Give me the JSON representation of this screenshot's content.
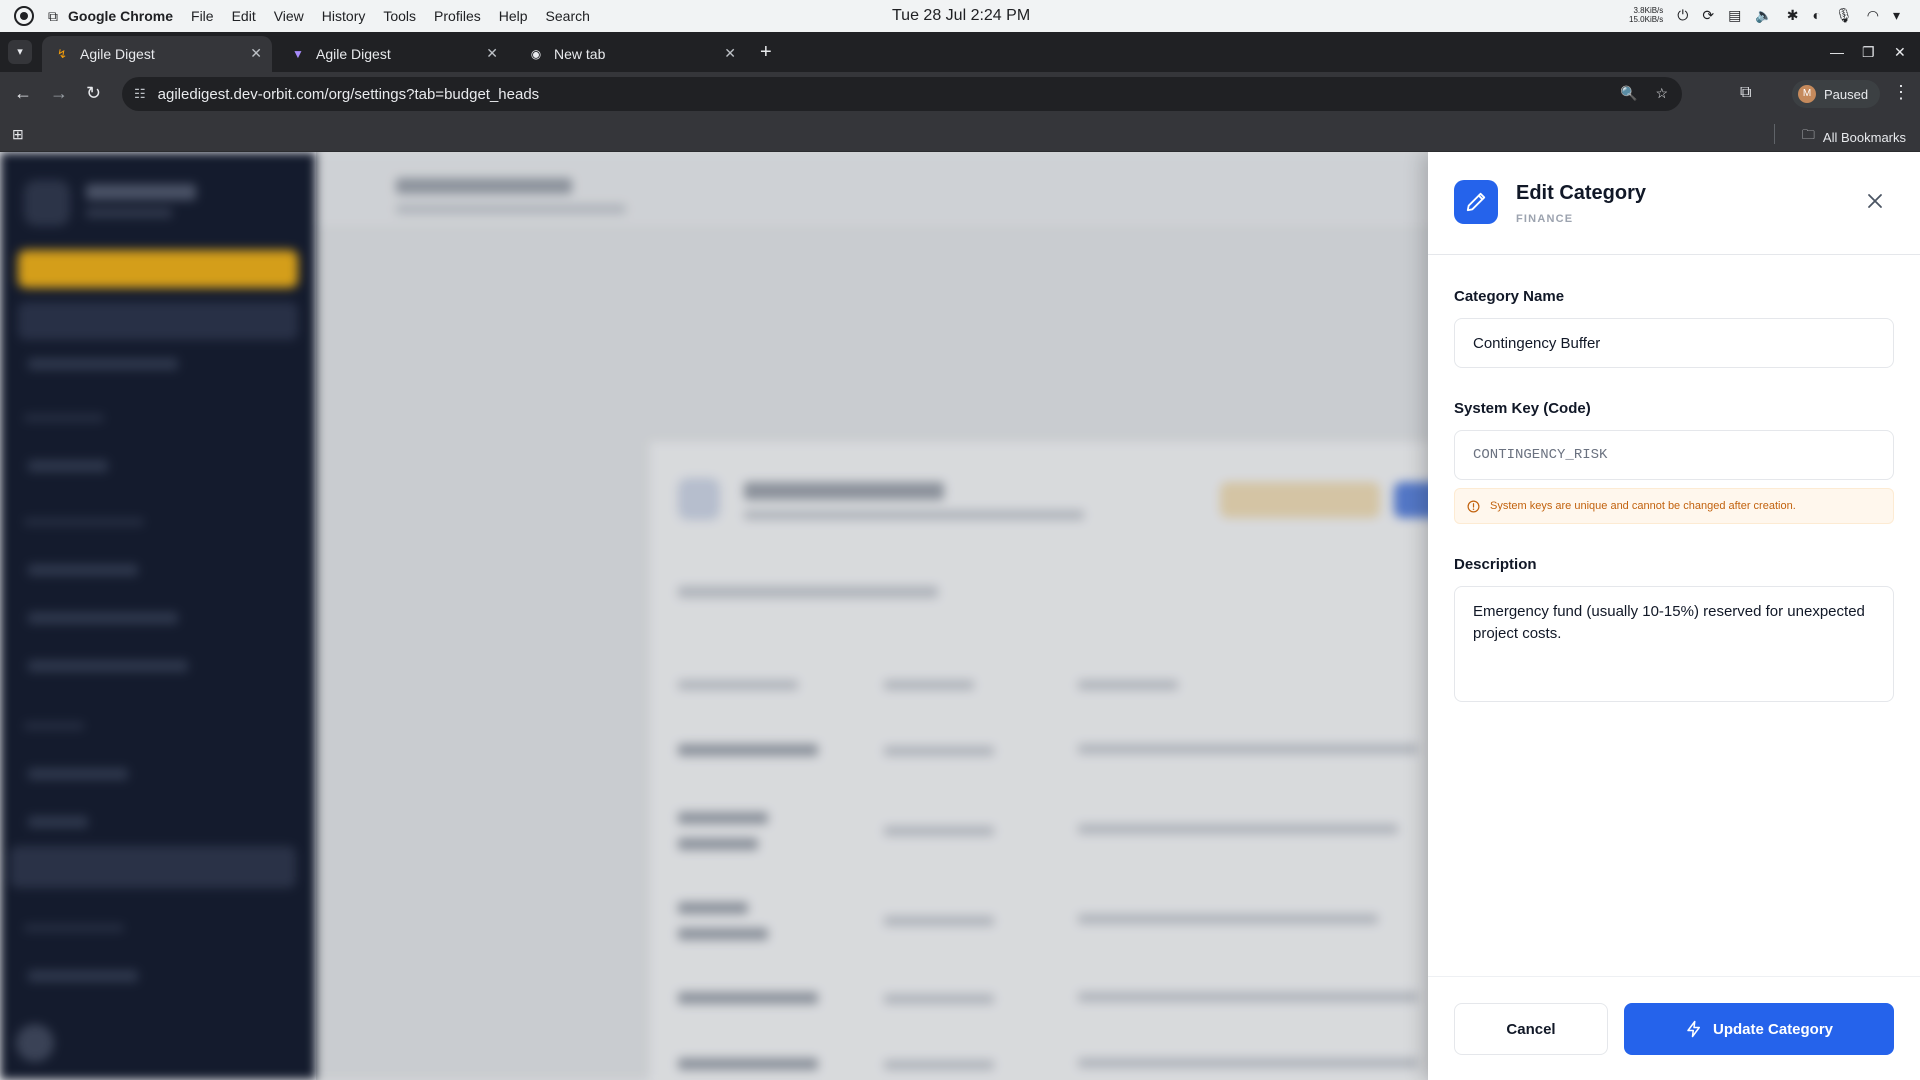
{
  "os": {
    "app_name": "Google Chrome",
    "menu": [
      "File",
      "Edit",
      "View",
      "History",
      "Tools",
      "Profiles",
      "Help",
      "Search"
    ],
    "clock": "Tue 28 Jul  2:24 PM",
    "net_up": "3.8KiB/s",
    "net_down": "15.0KiB/s"
  },
  "browser": {
    "tabs": [
      {
        "title": "Agile Digest",
        "active": true
      },
      {
        "title": "Agile Digest",
        "active": false
      },
      {
        "title": "New tab",
        "active": false
      }
    ],
    "url": "agiledigest.dev-orbit.com/org/settings?tab=budget_heads",
    "profile_initial": "M",
    "profile_status": "Paused",
    "bookmarks_label": "All Bookmarks"
  },
  "drawer": {
    "title": "Edit Category",
    "subtitle": "FINANCE",
    "fields": {
      "name_label": "Category Name",
      "name_value": "Contingency Buffer",
      "key_label": "System Key (Code)",
      "key_value": "CONTINGENCY_RISK",
      "key_warning": "System keys are unique and cannot be changed after creation.",
      "description_label": "Description",
      "description_value": "Emergency fund (usually 10-15%) reserved for unexpected project costs."
    },
    "footer": {
      "cancel_label": "Cancel",
      "update_label": "Update Category"
    }
  },
  "colors": {
    "primary": "#2563eb",
    "warning": "#c2620e",
    "sidebar": "#141b2d",
    "accent_yellow": "#d49e1a"
  }
}
